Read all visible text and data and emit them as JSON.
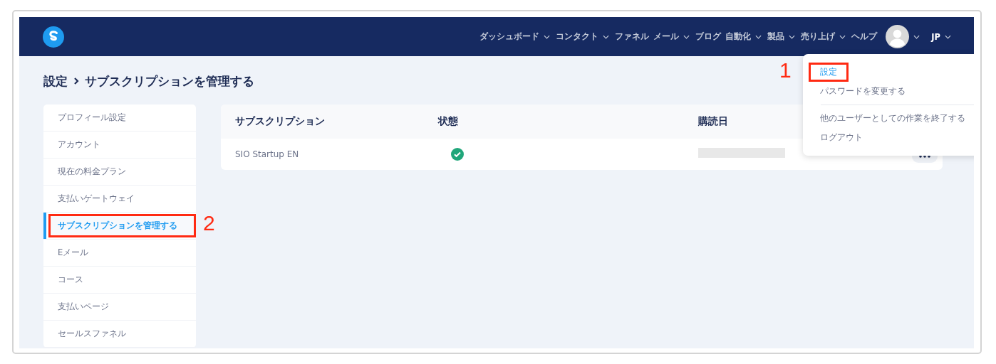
{
  "nav": {
    "items": [
      {
        "label": "ダッシュボード",
        "dropdown": true
      },
      {
        "label": "コンタクト",
        "dropdown": true
      },
      {
        "label": "ファネル",
        "dropdown": false
      },
      {
        "label": "メール",
        "dropdown": true
      },
      {
        "label": "ブログ",
        "dropdown": false
      },
      {
        "label": "自動化",
        "dropdown": true
      },
      {
        "label": "製品",
        "dropdown": true
      },
      {
        "label": "売り上げ",
        "dropdown": true
      },
      {
        "label": "ヘルプ",
        "dropdown": false
      }
    ],
    "language": "JP"
  },
  "breadcrumb": [
    {
      "label": "設定"
    },
    {
      "label": "サブスクリプションを管理する"
    }
  ],
  "sidebar": {
    "items": [
      {
        "label": "プロフィール設定",
        "selected": false
      },
      {
        "label": "アカウント",
        "selected": false
      },
      {
        "label": "現在の料金プラン",
        "selected": false
      },
      {
        "label": "支払いゲートウェイ",
        "selected": false
      },
      {
        "label": "サブスクリプションを管理する",
        "selected": true,
        "callout": "2"
      },
      {
        "label": "Eメール",
        "selected": false
      },
      {
        "label": "コース",
        "selected": false
      },
      {
        "label": "支払いページ",
        "selected": false
      },
      {
        "label": "セールスファネル",
        "selected": false
      }
    ]
  },
  "table": {
    "columns": [
      "サブスクリプション",
      "状態",
      "購読日"
    ],
    "rows": [
      {
        "name": "SIO Startup EN",
        "active": true,
        "date_redacted": true
      }
    ]
  },
  "user_menu": {
    "items": [
      {
        "label": "設定",
        "selected": true,
        "callout": "1"
      },
      {
        "label": "パスワードを変更する",
        "selected": false
      },
      {
        "label": "他のユーザーとしての作業を終了する",
        "selected": false,
        "divider_before": true
      },
      {
        "label": "ログアウト",
        "selected": false
      }
    ]
  }
}
